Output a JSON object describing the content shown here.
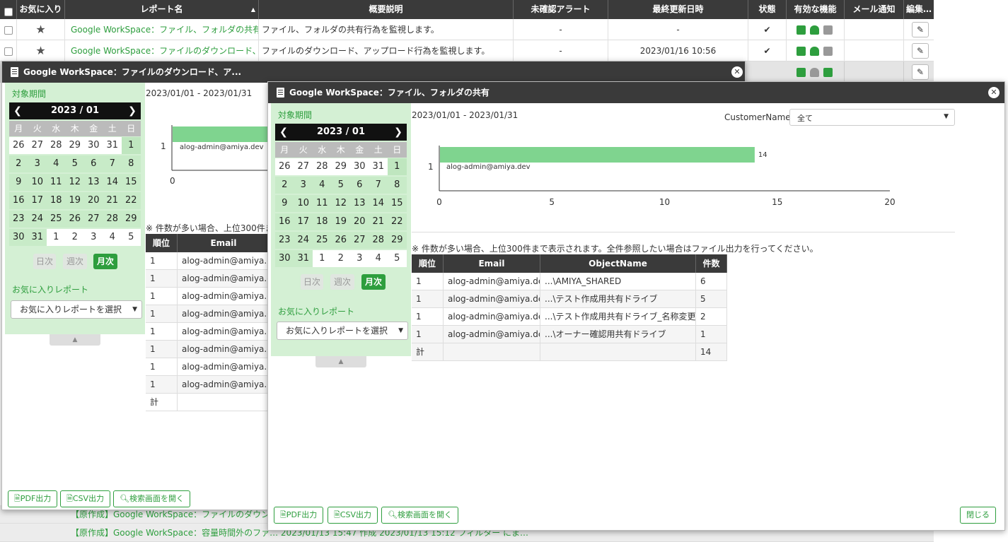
{
  "list": {
    "headers": [
      "お気に入り",
      "レポート名",
      "概要説明",
      "未確認アラート",
      "最終更新日時",
      "状態",
      "有効な機能",
      "メール通知",
      "編集…"
    ],
    "sort_indicator": "▲",
    "rows": [
      {
        "name": "Google WorkSpace：ファイル、フォルダの共有",
        "desc": "ファイル、フォルダの共有行為を監視します。",
        "alerts": "-",
        "updated": "-",
        "status": "✔"
      },
      {
        "name": "Google WorkSpace：ファイルのダウンロード、アップロード",
        "desc": "ファイルのダウンロード、アップロード行為を監視します。",
        "alerts": "-",
        "updated": "2023/01/16 10:56",
        "status": "✔"
      }
    ],
    "bottom_rows": [
      "【原作成】Google WorkSpace：ファイルのダウンロード…",
      "【原作成】Google WorkSpace：容量時間外のファ… 2023/01/13 15:47 作成 2023/01/13 15:12 フィルター にま…"
    ],
    "edit_icon": "pencil-icon"
  },
  "modal_back": {
    "title": "Google WorkSpace：ファイルのダウンロード、ア...",
    "period_label": "対象期間",
    "date_range": "2023/01/01 - 2023/01/31",
    "calendar_month": "2023 / 01",
    "dow": [
      "月",
      "火",
      "水",
      "木",
      "金",
      "土",
      "日"
    ],
    "weeks": [
      [
        "26",
        "27",
        "28",
        "29",
        "30",
        "31",
        "1"
      ],
      [
        "2",
        "3",
        "4",
        "5",
        "6",
        "7",
        "8"
      ],
      [
        "9",
        "10",
        "11",
        "12",
        "13",
        "14",
        "15"
      ],
      [
        "16",
        "17",
        "18",
        "19",
        "20",
        "21",
        "22"
      ],
      [
        "23",
        "24",
        "25",
        "26",
        "27",
        "28",
        "29"
      ],
      [
        "30",
        "31",
        "1",
        "2",
        "3",
        "4",
        "5"
      ]
    ],
    "period_buttons": [
      "日次",
      "週次",
      "月次"
    ],
    "fav_label": "お気に入りレポート",
    "fav_select": "お気に入りレポートを選択",
    "notice": "※ 件数が多い場合、上位300件ま",
    "table_headers": [
      "順位",
      "Email"
    ],
    "rows": [
      [
        "1",
        "alog-admin@amiya.dev"
      ],
      [
        "1",
        "alog-admin@amiya.dev"
      ],
      [
        "1",
        "alog-admin@amiya.dev"
      ],
      [
        "1",
        "alog-admin@amiya.dev"
      ],
      [
        "1",
        "alog-admin@amiya.dev"
      ],
      [
        "1",
        "alog-admin@amiya.dev"
      ],
      [
        "1",
        "alog-admin@amiya.dev"
      ],
      [
        "1",
        "alog-admin@amiya.dev"
      ]
    ],
    "total_label": "計",
    "chart_category": "1",
    "chart_bar_label": "alog-admin@amiya.dev",
    "chart_axis_start": "0",
    "buttons": [
      "PDF出力",
      "CSV出力",
      "検索画面を開く"
    ]
  },
  "modal_front": {
    "title": "Google WorkSpace：ファイル、フォルダの共有",
    "period_label": "対象期間",
    "date_range": "2023/01/01 - 2023/01/31",
    "calendar_month": "2023 / 01",
    "dow": [
      "月",
      "火",
      "水",
      "木",
      "金",
      "土",
      "日"
    ],
    "weeks": [
      [
        "26",
        "27",
        "28",
        "29",
        "30",
        "31",
        "1"
      ],
      [
        "2",
        "3",
        "4",
        "5",
        "6",
        "7",
        "8"
      ],
      [
        "9",
        "10",
        "11",
        "12",
        "13",
        "14",
        "15"
      ],
      [
        "16",
        "17",
        "18",
        "19",
        "20",
        "21",
        "22"
      ],
      [
        "23",
        "24",
        "25",
        "26",
        "27",
        "28",
        "29"
      ],
      [
        "30",
        "31",
        "1",
        "2",
        "3",
        "4",
        "5"
      ]
    ],
    "period_buttons": [
      "日次",
      "週次",
      "月次"
    ],
    "fav_label": "お気に入りレポート",
    "fav_select": "お気に入りレポートを選択",
    "filter_label": "CustomerName",
    "filter_value": "全て",
    "notice": "※ 件数が多い場合、上位300件まで表示されます。全件参照したい場合はファイル出力を行ってください。",
    "table_headers": [
      "順位",
      "Email",
      "ObjectName",
      "件数"
    ],
    "rows": [
      [
        "1",
        "alog-admin@amiya.dev",
        "...\\AMIYA_SHARED",
        "6"
      ],
      [
        "1",
        "alog-admin@amiya.dev",
        "...\\テスト作成用共有ドライブ",
        "5"
      ],
      [
        "1",
        "alog-admin@amiya.dev",
        "...\\テスト作成用共有ドライブ_名称変更",
        "2"
      ],
      [
        "1",
        "alog-admin@amiya.dev",
        "...\\オーナー確認用共有ドライブ",
        "1"
      ]
    ],
    "total_label": "計",
    "total_value": "14",
    "buttons": [
      "PDF出力",
      "CSV出力",
      "検索画面を開く"
    ],
    "close_button": "閉じる"
  },
  "chart_data": {
    "type": "bar",
    "orientation": "horizontal",
    "categories": [
      "1"
    ],
    "bar_labels": [
      "alog-admin@amiya.dev"
    ],
    "values": [
      14
    ],
    "xlim": [
      0,
      20
    ],
    "xticks": [
      "0",
      "5",
      "10",
      "15",
      "20"
    ],
    "data_labels": [
      "14"
    ],
    "bar_color": "#7fd48f",
    "grid": false
  },
  "colors": {
    "accent_green": "#2e9e3e",
    "header_dark": "#3a3a3a",
    "panel_green": "#d4f0d4",
    "bar_green": "#7fd48f"
  }
}
